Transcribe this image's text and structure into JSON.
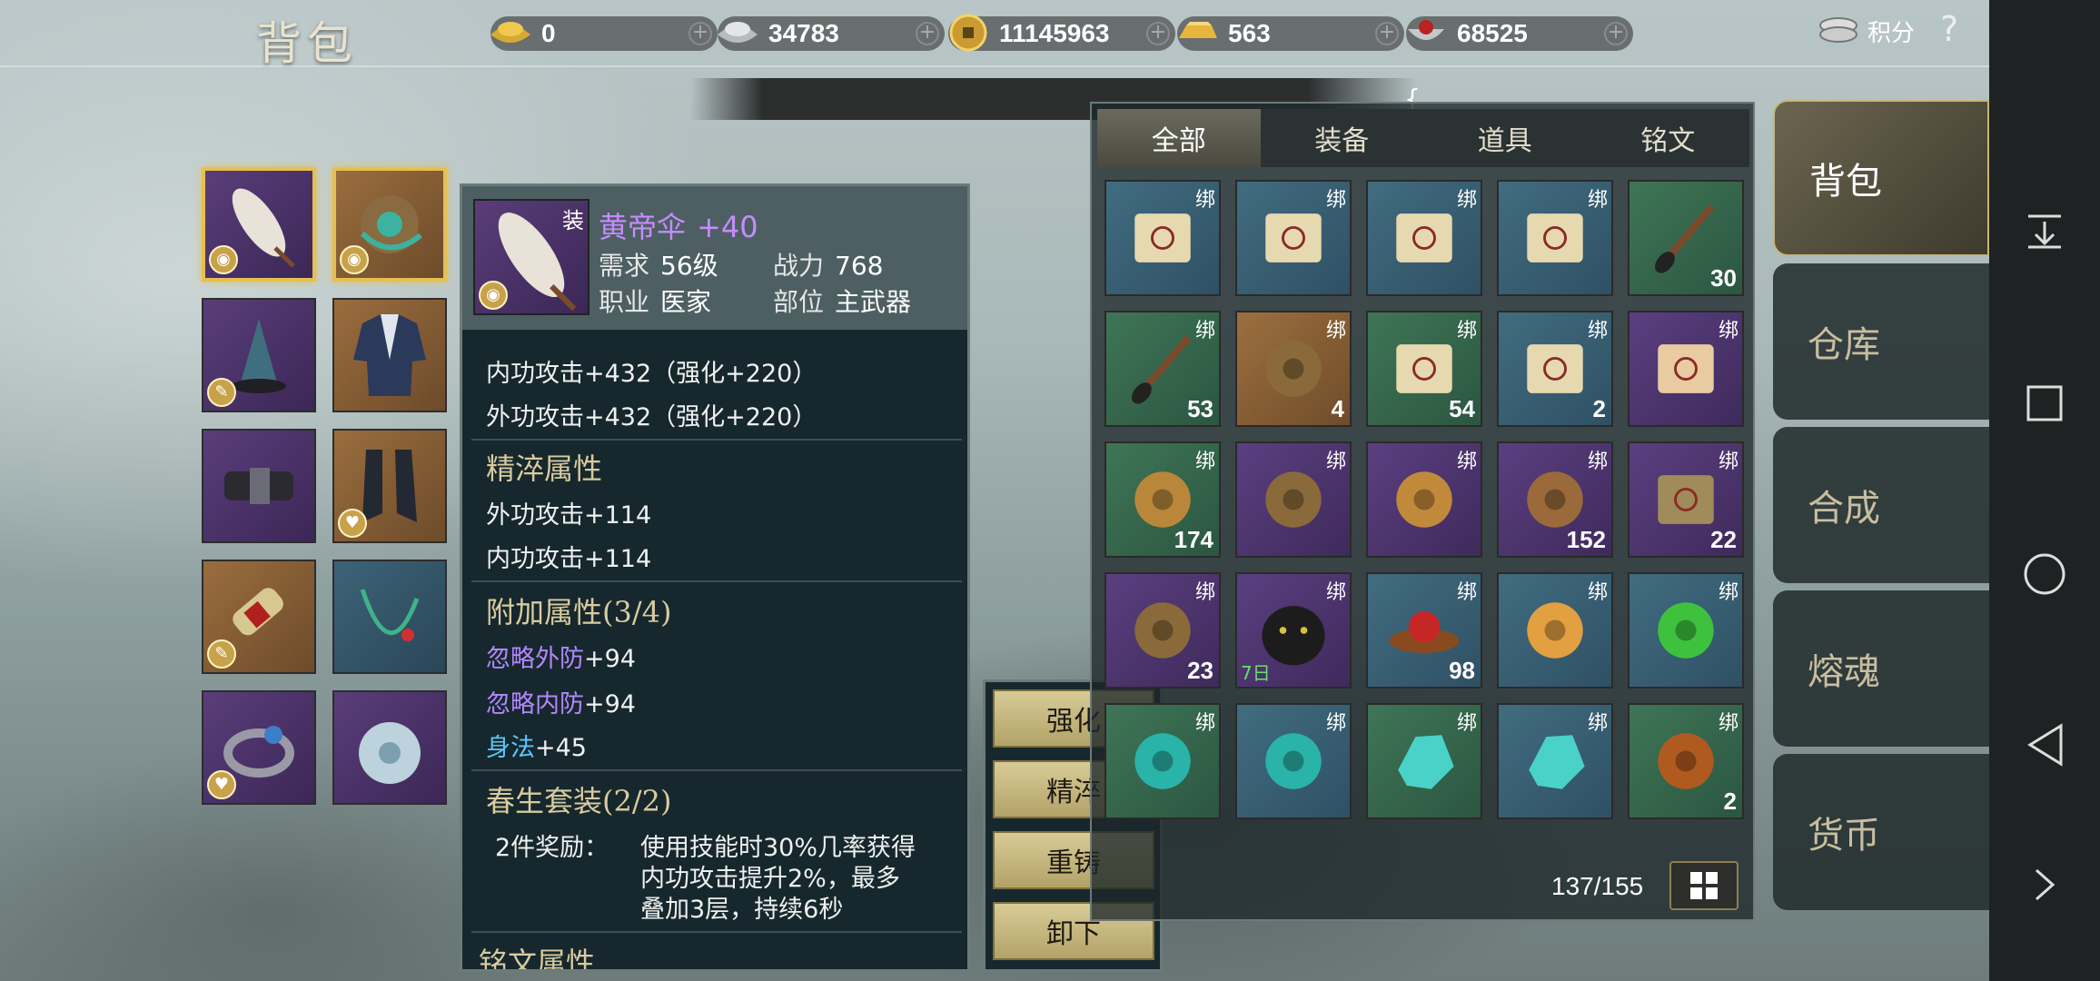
{
  "header": {
    "title": "背包",
    "currencies": [
      {
        "icon": "gold-ingot-icon",
        "value": "0"
      },
      {
        "icon": "silver-ingot-icon",
        "value": "34783"
      },
      {
        "icon": "copper-coin-icon",
        "value": "11145963"
      },
      {
        "icon": "gold-bar-icon",
        "value": "563"
      },
      {
        "icon": "silver-bowl-icon",
        "value": "68525"
      }
    ],
    "score_label": "积分",
    "help_label": "?",
    "close_label": "✕"
  },
  "notice": {
    "text": "{"
  },
  "equipment": {
    "slots": [
      {
        "icon": "umbrella-weapon-icon",
        "badge": "eye-badge-icon"
      },
      {
        "icon": "helmet-ornament-icon",
        "badge": "eye-badge-icon"
      },
      {
        "icon": "crown-headgear-icon",
        "badge": "feather-badge-icon"
      },
      {
        "icon": "robe-armor-icon",
        "badge": ""
      },
      {
        "icon": "belt-icon",
        "badge": ""
      },
      {
        "icon": "boots-icon",
        "badge": "heart-badge-icon"
      },
      {
        "icon": "bracer-icon",
        "badge": "feather-badge-icon"
      },
      {
        "icon": "necklace-icon",
        "badge": ""
      },
      {
        "icon": "ring-icon",
        "badge": "heart-badge-icon"
      },
      {
        "icon": "jade-pendant-icon",
        "badge": ""
      }
    ]
  },
  "tooltip": {
    "icon_tag": "装",
    "name": "黄帝伞",
    "level": "+40",
    "req_label": "需求",
    "req_value": "56级",
    "power_label": "战力",
    "power_value": "768",
    "class_label": "职业",
    "class_value": "医家",
    "slot_label": "部位",
    "slot_value": "主武器",
    "base_stats": [
      "内功攻击+432（强化+220）",
      "外功攻击+432（强化+220）"
    ],
    "refine_title": "精淬属性",
    "refine_stats": [
      "外功攻击+114",
      "内功攻击+114"
    ],
    "extra_title": "附加属性(3/4)",
    "extra_stats": [
      {
        "name": "忽略外防",
        "value": "+94"
      },
      {
        "name": "忽略内防",
        "value": "+94"
      },
      {
        "name": "身法",
        "value": "+45"
      }
    ],
    "set_title": "春生套装(2/2)",
    "set_bonus_label": "2件奖励：",
    "set_bonus_lines": [
      "使用技能时30%几率获得",
      "内功攻击提升2%，最多",
      "叠加3层，持续6秒"
    ],
    "inscription_title": "铭文属性"
  },
  "actions": [
    "强化",
    "精淬",
    "重铸",
    "卸下"
  ],
  "bag": {
    "tabs": [
      "全部",
      "装备",
      "道具",
      "铭文"
    ],
    "bind_label": "绑",
    "items": [
      {
        "icon": "scroll-icon",
        "bg": "blue",
        "count": ""
      },
      {
        "icon": "scroll-icon",
        "bg": "blue",
        "count": ""
      },
      {
        "icon": "scroll-icon",
        "bg": "blue",
        "count": ""
      },
      {
        "icon": "scroll-icon",
        "bg": "blue",
        "count": ""
      },
      {
        "icon": "brush-icon",
        "bg": "green",
        "count": "30"
      },
      {
        "icon": "brush-icon",
        "bg": "green",
        "count": "53"
      },
      {
        "icon": "mechanism-icon",
        "bg": "orange",
        "count": "4"
      },
      {
        "icon": "scroll-icon",
        "bg": "green",
        "count": "54"
      },
      {
        "icon": "scroll-icon",
        "bg": "blue",
        "count": "2"
      },
      {
        "icon": "letter-icon",
        "bg": "purple",
        "count": ""
      },
      {
        "icon": "astrolabe-icon",
        "bg": "green",
        "count": "174"
      },
      {
        "icon": "mechanism-icon",
        "bg": "purple",
        "count": ""
      },
      {
        "icon": "orb-icon",
        "bg": "purple",
        "count": ""
      },
      {
        "icon": "key-gear-icon",
        "bg": "purple",
        "count": "152"
      },
      {
        "icon": "talisman-icon",
        "bg": "purple",
        "count": "22"
      },
      {
        "icon": "mechanism-icon",
        "bg": "purple",
        "count": "23"
      },
      {
        "icon": "panther-icon",
        "bg": "purple",
        "count": "",
        "duration": "7日"
      },
      {
        "icon": "red-orb-icon",
        "bg": "blue",
        "count": "98"
      },
      {
        "icon": "orange-gem-icon",
        "bg": "blue",
        "count": ""
      },
      {
        "icon": "green-jade-icon",
        "bg": "blue",
        "count": ""
      },
      {
        "icon": "teal-stone-icon",
        "bg": "green",
        "count": ""
      },
      {
        "icon": "teal-stone-icon",
        "bg": "blue",
        "count": ""
      },
      {
        "icon": "crystal-icon",
        "bg": "green",
        "count": ""
      },
      {
        "icon": "crystal-icon",
        "bg": "blue",
        "count": ""
      },
      {
        "icon": "amber-stone-icon",
        "bg": "green",
        "count": "2"
      }
    ],
    "capacity": "137/155"
  },
  "sidenav": [
    "背包",
    "仓库",
    "合成",
    "熔魂",
    "货币"
  ],
  "colors": {
    "accent": "#e4c053",
    "tooltip_name": "#c58cff",
    "extra_purple": "#b387ff",
    "extra_cyan": "#59c8ff"
  }
}
